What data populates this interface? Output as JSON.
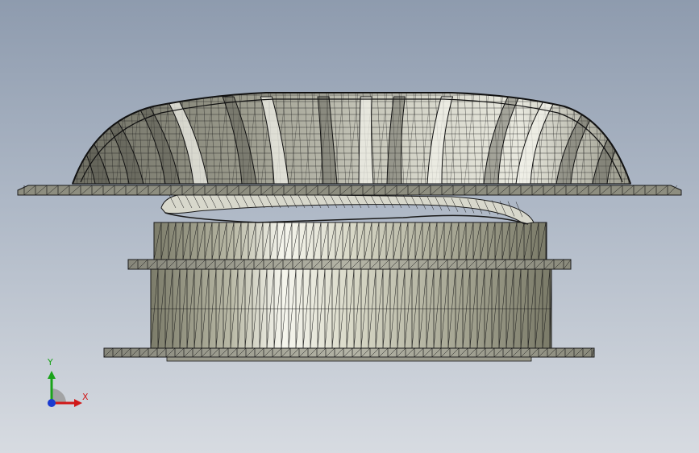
{
  "viewport": {
    "background_top": "#8e9bae",
    "background_bottom": "#d7dbe1",
    "model_fill": "#8a8a7a",
    "model_highlight": "#f4f4ea",
    "wire_color": "#1a1a1a"
  },
  "triad": {
    "x_label": "X",
    "y_label": "Y",
    "x_color": "#d01818",
    "y_color": "#1aa31a",
    "z_color": "#1a3ad0"
  }
}
